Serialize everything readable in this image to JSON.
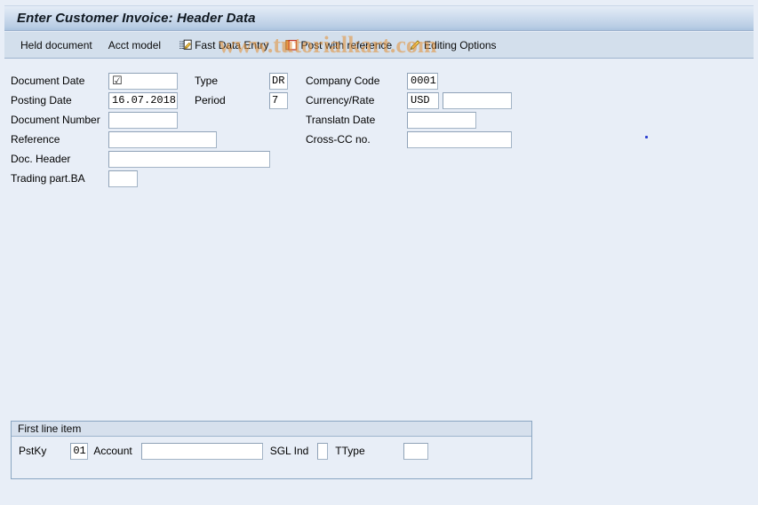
{
  "window": {
    "title": "Enter Customer Invoice: Header Data"
  },
  "watermark": {
    "text": "www.tutorialkart.com"
  },
  "toolbar": {
    "items": [
      {
        "label": "Held document",
        "icon": "none"
      },
      {
        "label": "Acct model",
        "icon": "none"
      },
      {
        "label": "Fast Data Entry",
        "icon": "fast-data-entry-icon"
      },
      {
        "label": "Post with reference",
        "icon": "post-with-reference-icon"
      },
      {
        "label": "Editing Options",
        "icon": "pencil-icon"
      }
    ]
  },
  "header_form": {
    "left": [
      {
        "label": "Document Date",
        "value": "",
        "placeholder": ""
      },
      {
        "label": "Posting Date",
        "value": "16.07.2018",
        "placeholder": ""
      },
      {
        "label": "Document Number",
        "value": "",
        "placeholder": ""
      },
      {
        "label": "Reference",
        "value": "",
        "placeholder": ""
      },
      {
        "label": "Doc. Header",
        "value": "",
        "placeholder": ""
      },
      {
        "label": "Trading part.BA",
        "value": "",
        "placeholder": ""
      }
    ],
    "middle": [
      {
        "label": "Type",
        "value": "DR"
      },
      {
        "label": "Period",
        "value": "7"
      }
    ],
    "right": [
      {
        "label": "Company Code",
        "value": "0001"
      },
      {
        "label": "Currency/Rate",
        "value": "USD",
        "value2": ""
      },
      {
        "label": "Translatn Date",
        "value": ""
      },
      {
        "label": "Cross-CC no.",
        "value": ""
      }
    ],
    "document_date_icon": "checkbox-checked-icon",
    "document_date_glyph": "☑"
  },
  "first_line_item": {
    "title": "First line item",
    "pstky_label": "PstKy",
    "pstky_value": "01",
    "account_label": "Account",
    "account_value": "",
    "sgl_ind_label": "SGL Ind",
    "sgl_ind_value": "",
    "ttype_label": "TType",
    "ttype_value": ""
  },
  "colors": {
    "page_background": "#e8eef7",
    "title_bar": "#b9cde4",
    "toolbar": "#d3dfec",
    "field_border": "#a3b4c6",
    "watermark": "#e2923d",
    "marker_dot": "#2b3ed0"
  }
}
